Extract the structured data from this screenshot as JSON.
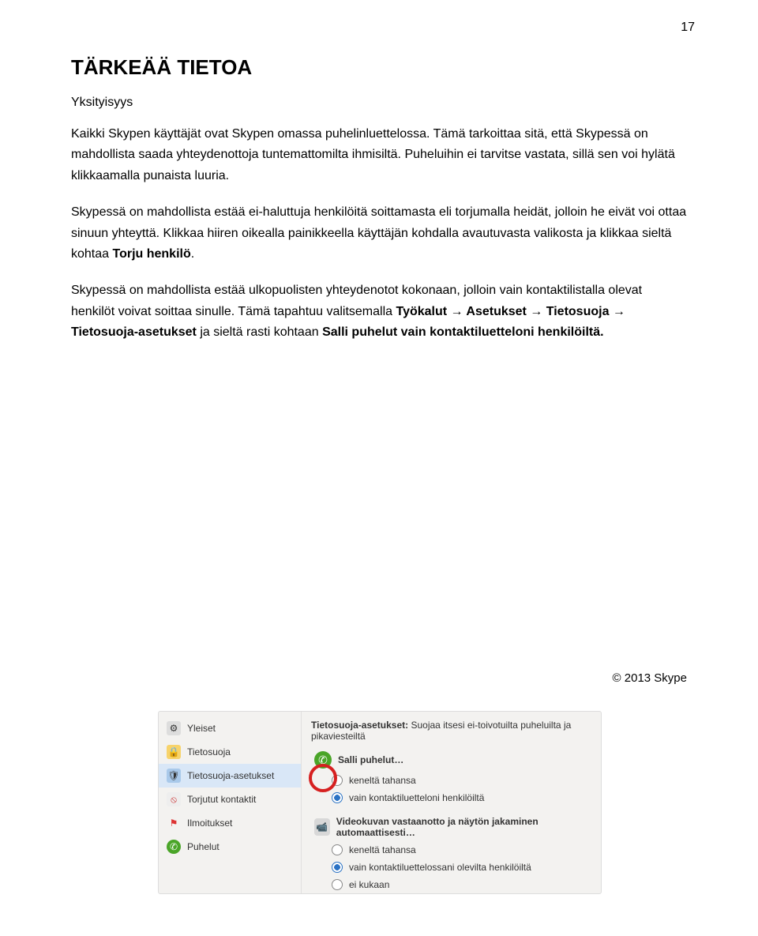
{
  "page_number": "17",
  "title": "TÄRKEÄÄ TIETOA",
  "subtitle": "Yksityisyys",
  "para1": "Kaikki Skypen käyttäjät ovat Skypen omassa puhelinluettelossa. Tämä tarkoittaa sitä, että Skypessä on mahdollista saada yhteydenottoja tuntemattomilta ihmisiltä. Puheluihin ei tarvitse vastata, sillä sen voi hylätä klikkaamalla punaista luuria.",
  "para2a": "Skypessä on mahdollista estää ei-haluttuja henkilöitä soittamasta eli torjumalla heidät, jolloin he eivät voi ottaa sinuun yhteyttä. Klikkaa hiiren oikealla painikkeella käyttäjän kohdalla avautuvasta valikosta ja klikkaa sieltä kohtaa ",
  "para2b": "Torju henkilö",
  "para2c": ".",
  "para3a": "Skypessä on mahdollista estää ulkopuolisten yhteydenotot kokonaan, jolloin vain kontaktilistalla olevat henkilöt voivat soittaa sinulle. Tämä tapahtuu valitsemalla ",
  "para3b": "Työkalut → Asetukset → Tietosuoja → Tietosuoja-asetukset",
  "para3c": " ja sieltä rasti kohtaan ",
  "para3d": "Salli puhelut vain kontaktiluetteloni henkilöiltä.",
  "copyright": "© 2013 Skype",
  "shot": {
    "sidebar": {
      "yleiset": "Yleiset",
      "tietosuoja": "Tietosuoja",
      "asetukset": "Tietosuoja-asetukset",
      "torjutut": "Torjutut kontaktit",
      "ilmoitukset": "Ilmoitukset",
      "puhelut": "Puhelut"
    },
    "main": {
      "header": "Tietosuoja-asetukset:",
      "header2": " Suojaa itsesi ei-toivotuilta puheluilta ja pikaviesteiltä",
      "calls": "Salli puhelut…",
      "opt1": "keneltä tahansa",
      "opt2": "vain kontaktiluetteloni henkilöiltä",
      "video": "Videokuvan vastaanotto ja näytön jakaminen automaattisesti…",
      "vopt1": "keneltä tahansa",
      "vopt2": "vain kontaktiluettelossani olevilta henkilöiltä",
      "vopt3": "ei kukaan"
    }
  }
}
